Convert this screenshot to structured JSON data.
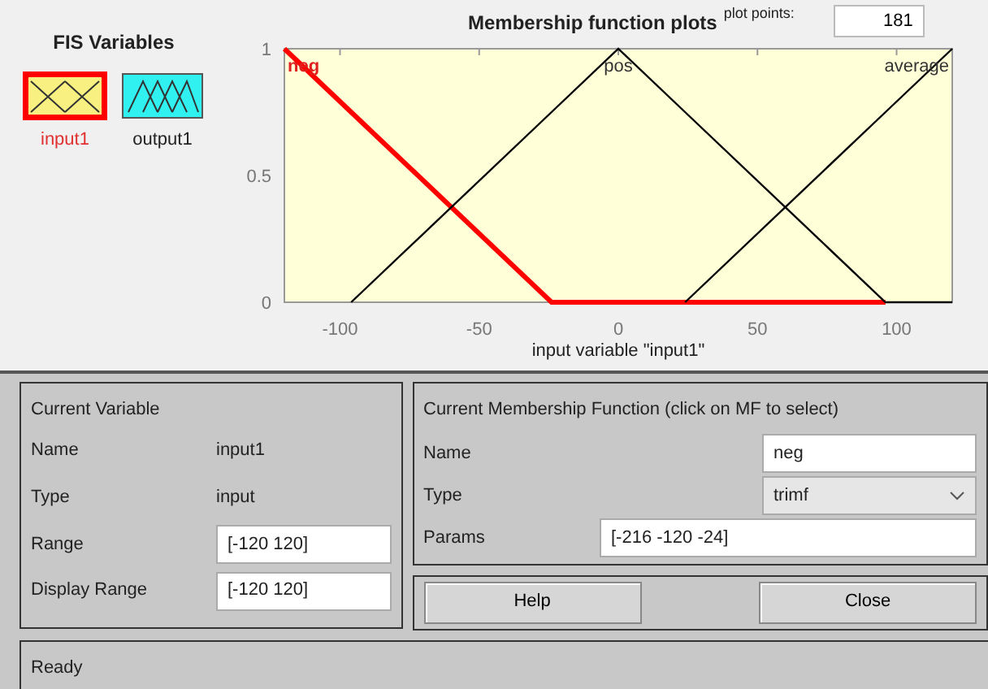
{
  "fis_variables": {
    "title": "FIS Variables",
    "items": [
      {
        "label": "input1",
        "kind": "input",
        "selected": true
      },
      {
        "label": "output1",
        "kind": "output",
        "selected": false
      }
    ]
  },
  "plot": {
    "plot_points_label": "plot points:",
    "plot_points": "181",
    "chart_data": {
      "type": "line",
      "title": "Membership function plots",
      "xlabel": "input variable \"input1\"",
      "x": [
        -120,
        -96,
        -24,
        0,
        24,
        96,
        120
      ],
      "series": [
        {
          "name": "neg",
          "color": "#ff0000",
          "values": [
            1,
            0.75,
            0,
            0,
            0,
            0,
            null
          ]
        },
        {
          "name": "pos",
          "color": "#000000",
          "values": [
            null,
            0,
            0.75,
            1,
            0.75,
            0,
            0
          ]
        },
        {
          "name": "average",
          "color": "#000000",
          "values": [
            null,
            null,
            null,
            null,
            0,
            0.75,
            1
          ]
        }
      ],
      "xlim": [
        -120,
        120
      ],
      "ylim": [
        0,
        1
      ],
      "xticks": [
        -100,
        -50,
        0,
        50,
        100
      ],
      "yticks": [
        0,
        0.5,
        1
      ]
    }
  },
  "current_variable": {
    "title": "Current Variable",
    "rows": [
      {
        "label": "Name",
        "kind": "text",
        "value": "input1"
      },
      {
        "label": "Type",
        "kind": "text",
        "value": "input"
      },
      {
        "label": "Range",
        "kind": "field",
        "value": "[-120 120]"
      },
      {
        "label": "Display Range",
        "kind": "field",
        "value": "[-120 120]"
      }
    ]
  },
  "current_mf": {
    "title": "Current Membership Function (click on MF to select)",
    "rows": [
      {
        "label": "Name",
        "kind": "field",
        "value": "neg"
      },
      {
        "label": "Type",
        "kind": "select",
        "value": "trimf"
      },
      {
        "label": "Params",
        "kind": "wide",
        "value": "[-216 -120 -24]"
      }
    ]
  },
  "buttons": [
    "Help",
    "Close"
  ],
  "status": "Ready"
}
